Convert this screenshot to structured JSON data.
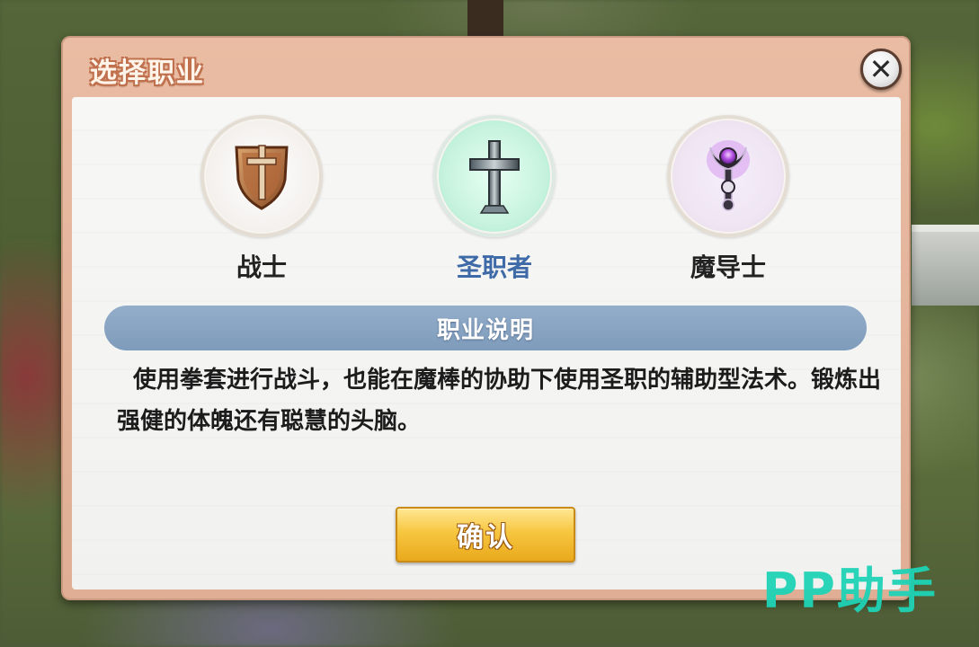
{
  "dialog": {
    "title": "选择职业",
    "close_icon": "close-icon"
  },
  "classes": [
    {
      "name": "战士",
      "icon": "shield-sword-icon",
      "selected": false
    },
    {
      "name": "圣职者",
      "icon": "cross-icon",
      "selected": true
    },
    {
      "name": "魔导士",
      "icon": "magic-staff-icon",
      "selected": false
    }
  ],
  "section": {
    "title": "职业说明",
    "description": "使用拳套进行战斗，也能在魔棒的协助下使用圣职的辅助型法术。锻炼出强健的体魄还有聪慧的头脑。"
  },
  "confirm_label": "确认",
  "watermark": "PP助手",
  "colors": {
    "selected_class": "#3f6aa8",
    "section_bar": "#8aa5c3",
    "confirm_button": "#f7c640",
    "watermark": "#1fd3b6"
  }
}
